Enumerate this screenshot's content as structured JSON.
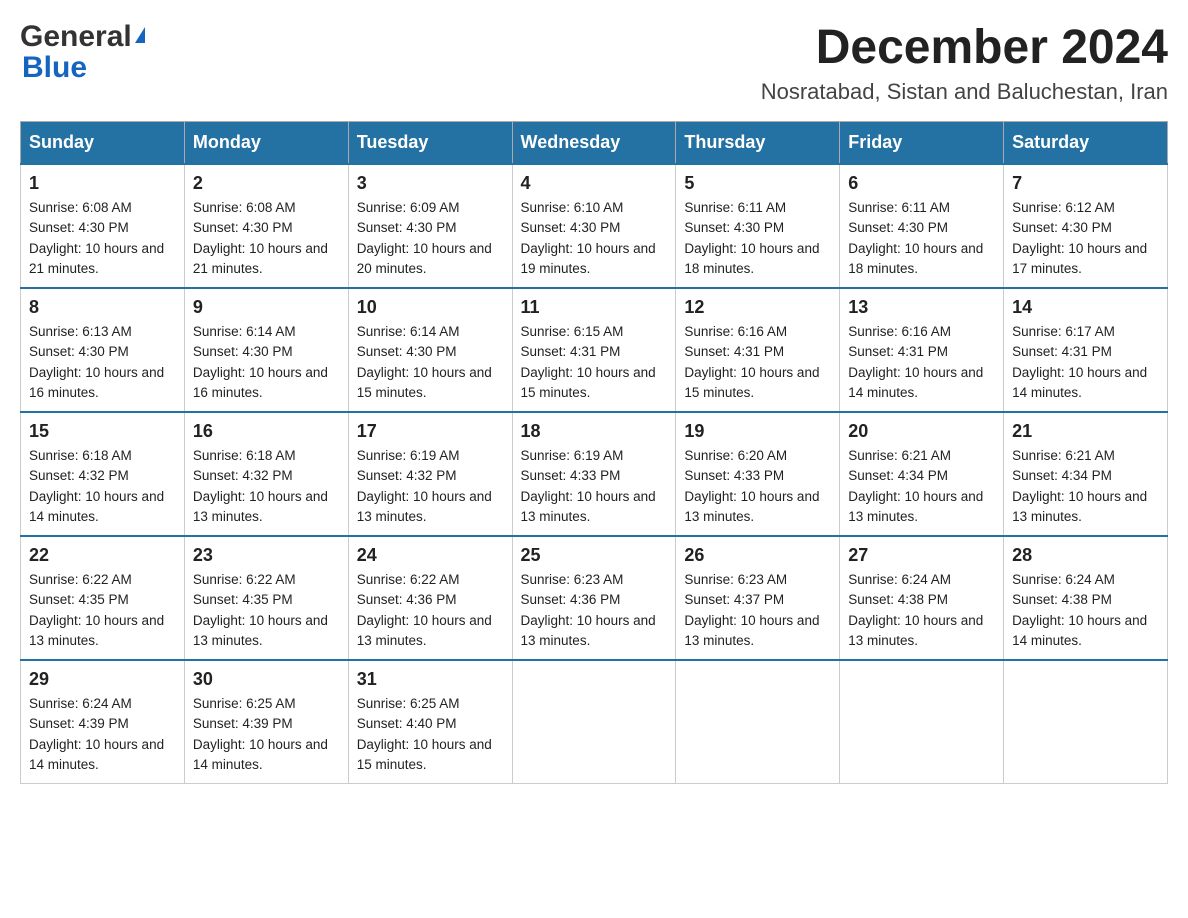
{
  "logo": {
    "general": "General",
    "blue": "Blue"
  },
  "header": {
    "month": "December 2024",
    "location": "Nosratabad, Sistan and Baluchestan, Iran"
  },
  "days_of_week": [
    "Sunday",
    "Monday",
    "Tuesday",
    "Wednesday",
    "Thursday",
    "Friday",
    "Saturday"
  ],
  "weeks": [
    [
      {
        "day": "1",
        "sunrise": "6:08 AM",
        "sunset": "4:30 PM",
        "daylight": "10 hours and 21 minutes."
      },
      {
        "day": "2",
        "sunrise": "6:08 AM",
        "sunset": "4:30 PM",
        "daylight": "10 hours and 21 minutes."
      },
      {
        "day": "3",
        "sunrise": "6:09 AM",
        "sunset": "4:30 PM",
        "daylight": "10 hours and 20 minutes."
      },
      {
        "day": "4",
        "sunrise": "6:10 AM",
        "sunset": "4:30 PM",
        "daylight": "10 hours and 19 minutes."
      },
      {
        "day": "5",
        "sunrise": "6:11 AM",
        "sunset": "4:30 PM",
        "daylight": "10 hours and 18 minutes."
      },
      {
        "day": "6",
        "sunrise": "6:11 AM",
        "sunset": "4:30 PM",
        "daylight": "10 hours and 18 minutes."
      },
      {
        "day": "7",
        "sunrise": "6:12 AM",
        "sunset": "4:30 PM",
        "daylight": "10 hours and 17 minutes."
      }
    ],
    [
      {
        "day": "8",
        "sunrise": "6:13 AM",
        "sunset": "4:30 PM",
        "daylight": "10 hours and 16 minutes."
      },
      {
        "day": "9",
        "sunrise": "6:14 AM",
        "sunset": "4:30 PM",
        "daylight": "10 hours and 16 minutes."
      },
      {
        "day": "10",
        "sunrise": "6:14 AM",
        "sunset": "4:30 PM",
        "daylight": "10 hours and 15 minutes."
      },
      {
        "day": "11",
        "sunrise": "6:15 AM",
        "sunset": "4:31 PM",
        "daylight": "10 hours and 15 minutes."
      },
      {
        "day": "12",
        "sunrise": "6:16 AM",
        "sunset": "4:31 PM",
        "daylight": "10 hours and 15 minutes."
      },
      {
        "day": "13",
        "sunrise": "6:16 AM",
        "sunset": "4:31 PM",
        "daylight": "10 hours and 14 minutes."
      },
      {
        "day": "14",
        "sunrise": "6:17 AM",
        "sunset": "4:31 PM",
        "daylight": "10 hours and 14 minutes."
      }
    ],
    [
      {
        "day": "15",
        "sunrise": "6:18 AM",
        "sunset": "4:32 PM",
        "daylight": "10 hours and 14 minutes."
      },
      {
        "day": "16",
        "sunrise": "6:18 AM",
        "sunset": "4:32 PM",
        "daylight": "10 hours and 13 minutes."
      },
      {
        "day": "17",
        "sunrise": "6:19 AM",
        "sunset": "4:32 PM",
        "daylight": "10 hours and 13 minutes."
      },
      {
        "day": "18",
        "sunrise": "6:19 AM",
        "sunset": "4:33 PM",
        "daylight": "10 hours and 13 minutes."
      },
      {
        "day": "19",
        "sunrise": "6:20 AM",
        "sunset": "4:33 PM",
        "daylight": "10 hours and 13 minutes."
      },
      {
        "day": "20",
        "sunrise": "6:21 AM",
        "sunset": "4:34 PM",
        "daylight": "10 hours and 13 minutes."
      },
      {
        "day": "21",
        "sunrise": "6:21 AM",
        "sunset": "4:34 PM",
        "daylight": "10 hours and 13 minutes."
      }
    ],
    [
      {
        "day": "22",
        "sunrise": "6:22 AM",
        "sunset": "4:35 PM",
        "daylight": "10 hours and 13 minutes."
      },
      {
        "day": "23",
        "sunrise": "6:22 AM",
        "sunset": "4:35 PM",
        "daylight": "10 hours and 13 minutes."
      },
      {
        "day": "24",
        "sunrise": "6:22 AM",
        "sunset": "4:36 PM",
        "daylight": "10 hours and 13 minutes."
      },
      {
        "day": "25",
        "sunrise": "6:23 AM",
        "sunset": "4:36 PM",
        "daylight": "10 hours and 13 minutes."
      },
      {
        "day": "26",
        "sunrise": "6:23 AM",
        "sunset": "4:37 PM",
        "daylight": "10 hours and 13 minutes."
      },
      {
        "day": "27",
        "sunrise": "6:24 AM",
        "sunset": "4:38 PM",
        "daylight": "10 hours and 13 minutes."
      },
      {
        "day": "28",
        "sunrise": "6:24 AM",
        "sunset": "4:38 PM",
        "daylight": "10 hours and 14 minutes."
      }
    ],
    [
      {
        "day": "29",
        "sunrise": "6:24 AM",
        "sunset": "4:39 PM",
        "daylight": "10 hours and 14 minutes."
      },
      {
        "day": "30",
        "sunrise": "6:25 AM",
        "sunset": "4:39 PM",
        "daylight": "10 hours and 14 minutes."
      },
      {
        "day": "31",
        "sunrise": "6:25 AM",
        "sunset": "4:40 PM",
        "daylight": "10 hours and 15 minutes."
      },
      null,
      null,
      null,
      null
    ]
  ]
}
